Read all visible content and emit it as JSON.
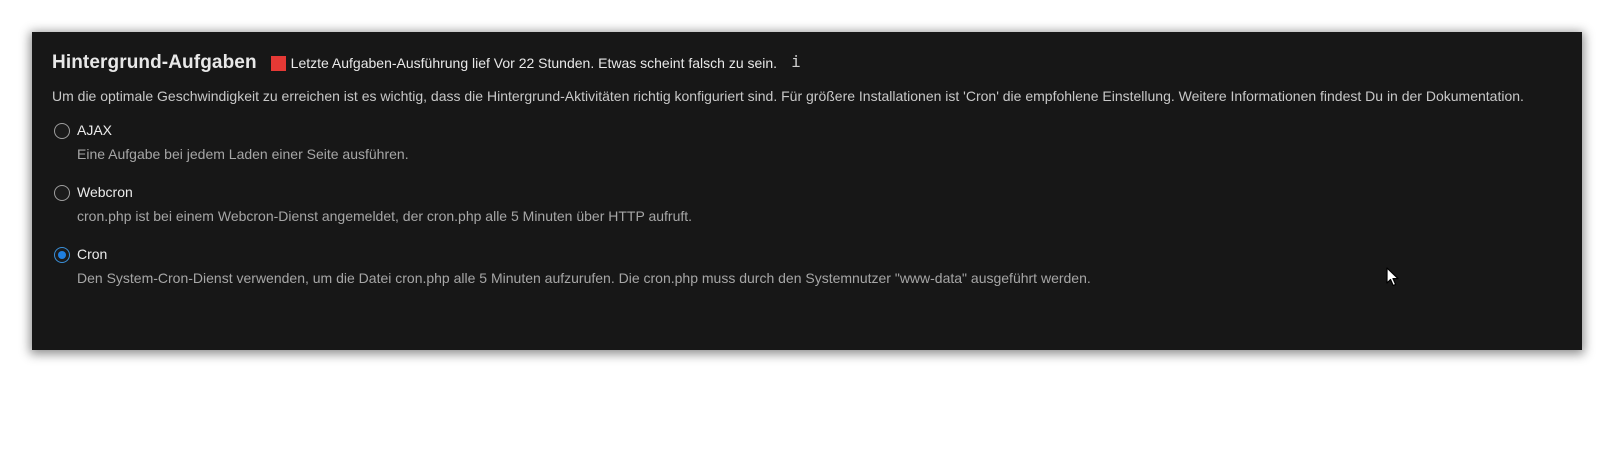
{
  "section": {
    "title": "Hintergrund-Aufgaben",
    "status": {
      "color": "#e53935",
      "text": "Letzte Aufgaben-Ausführung lief Vor 22 Stunden. Etwas scheint falsch zu sein."
    },
    "info_icon": "i",
    "description": "Um die optimale Geschwindigkeit zu erreichen ist es wichtig, dass die Hintergrund-Aktivitäten richtig konfiguriert sind. Für größere Installationen ist 'Cron' die empfohlene Einstellung. Weitere Informationen findest Du in der Dokumentation."
  },
  "options": [
    {
      "label": "AJAX",
      "hint": "Eine Aufgabe bei jedem Laden einer Seite ausführen.",
      "selected": false
    },
    {
      "label": "Webcron",
      "hint": "cron.php ist bei einem Webcron-Dienst angemeldet, der cron.php alle 5 Minuten über HTTP aufruft.",
      "selected": false
    },
    {
      "label": "Cron",
      "hint": "Den System-Cron-Dienst verwenden, um die Datei cron.php alle 5 Minuten aufzurufen. Die cron.php muss durch den Systemnutzer \"www-data\" ausgeführt werden.",
      "selected": true
    }
  ],
  "colors": {
    "panel_background": "#171717",
    "accent": "#1f7fe0",
    "error": "#e53935"
  }
}
